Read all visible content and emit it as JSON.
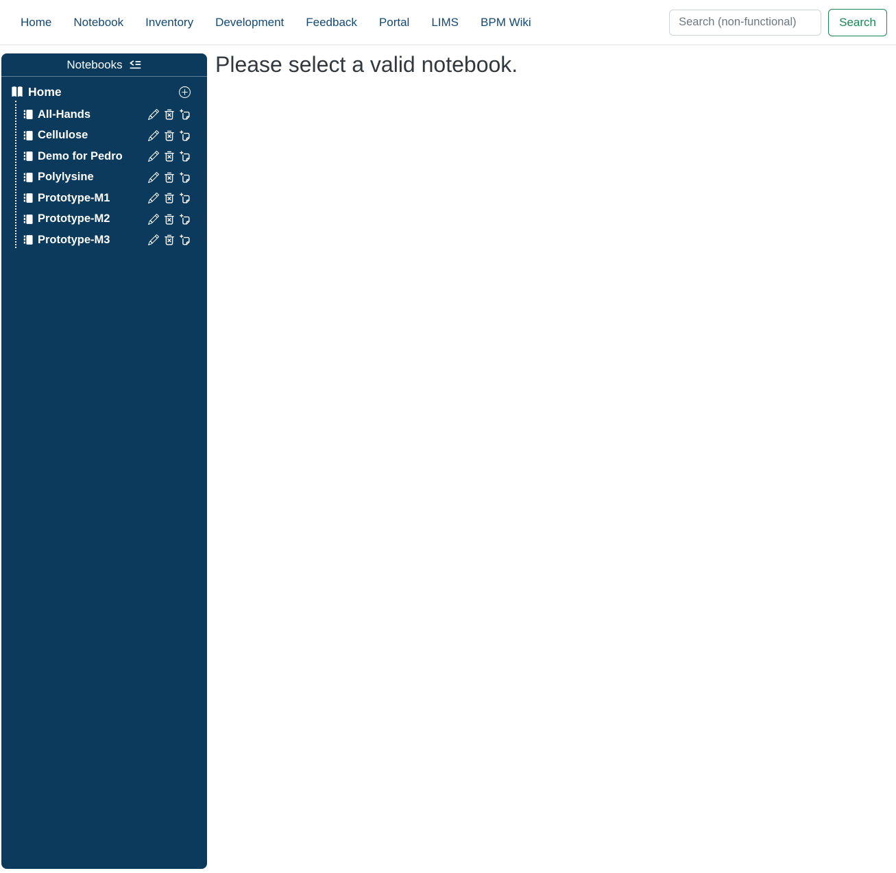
{
  "nav": {
    "items": [
      {
        "label": "Home"
      },
      {
        "label": "Notebook"
      },
      {
        "label": "Inventory"
      },
      {
        "label": "Development"
      },
      {
        "label": "Feedback"
      },
      {
        "label": "Portal"
      },
      {
        "label": "LIMS"
      },
      {
        "label": "BPM Wiki"
      }
    ],
    "search_placeholder": "Search (non-functional)",
    "search_button_label": "Search"
  },
  "sidebar": {
    "title": "Notebooks",
    "home_label": "Home",
    "notebooks": [
      {
        "label": "All-Hands"
      },
      {
        "label": "Cellulose"
      },
      {
        "label": "Demo for Pedro"
      },
      {
        "label": "Polylysine"
      },
      {
        "label": "Prototype-M1"
      },
      {
        "label": "Prototype-M2"
      },
      {
        "label": "Prototype-M3"
      }
    ],
    "item_action_icons": [
      "edit-pencil-icon",
      "delete-trash-icon",
      "duplicate-copy-icon"
    ],
    "header_icon": "collapse-outdent-icon",
    "home_icons": [
      "open-book-icon",
      "add-plus-circle-icon"
    ],
    "item_icon": "journal-icon"
  },
  "main": {
    "message": "Please select a valid notebook."
  },
  "colors": {
    "sidebar_bg": "#0c3a5c",
    "nav_link": "#124972",
    "accent_green": "#198754",
    "message_text": "#32383e",
    "divider": "#dee2e6"
  }
}
